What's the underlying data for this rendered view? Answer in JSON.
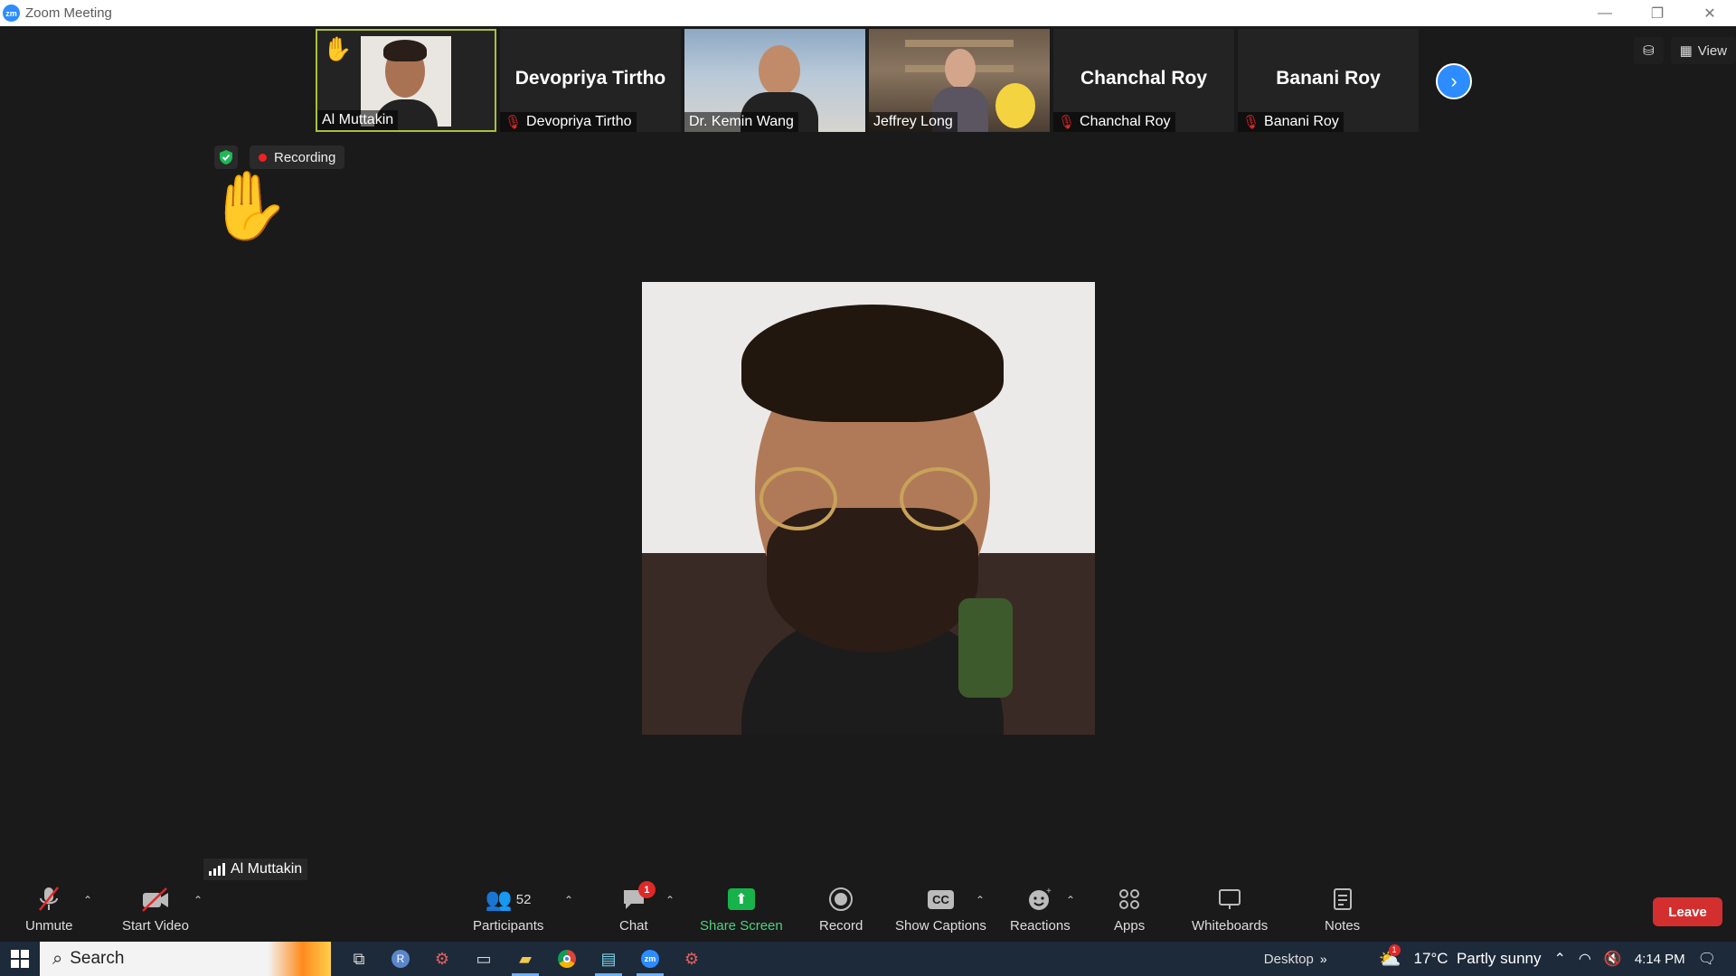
{
  "window": {
    "title": "Zoom Meeting",
    "logo_text": "zm"
  },
  "gallery": {
    "tiles": [
      {
        "name": "Al Muttakin",
        "raised_hand": true,
        "video": true
      },
      {
        "name": "Devopriya Tirtho",
        "big_name": "Devopriya Tirtho",
        "muted": true
      },
      {
        "name": "Dr. Kemin Wang",
        "video": true
      },
      {
        "name": "Jeffrey Long",
        "video": true
      },
      {
        "name": "Chanchal Roy",
        "big_name": "Chanchal Roy",
        "muted": true
      },
      {
        "name": "Banani Roy",
        "big_name": "Banani Roy",
        "muted": true
      }
    ]
  },
  "top_right": {
    "view_label": "View"
  },
  "status": {
    "recording_label": "Recording"
  },
  "active_speaker": {
    "name": "Al Muttakin"
  },
  "toolbar": {
    "unmute": "Unmute",
    "start_video": "Start Video",
    "participants": "Participants",
    "participants_count": "52",
    "chat": "Chat",
    "chat_badge": "1",
    "share_screen": "Share Screen",
    "record": "Record",
    "show_captions": "Show Captions",
    "captions_icon": "CC",
    "reactions": "Reactions",
    "apps": "Apps",
    "whiteboards": "Whiteboards",
    "notes": "Notes",
    "leave": "Leave"
  },
  "taskbar": {
    "search_label": "Search",
    "desktop_label": "Desktop",
    "weather": "17°C  Partly sunny",
    "weather_badge": "1",
    "time": "4:14 PM"
  },
  "colors": {
    "accent": "#2d8cff",
    "leave": "#d32f2f",
    "share": "#17b34a",
    "active_tile_border": "#a7c13d"
  }
}
